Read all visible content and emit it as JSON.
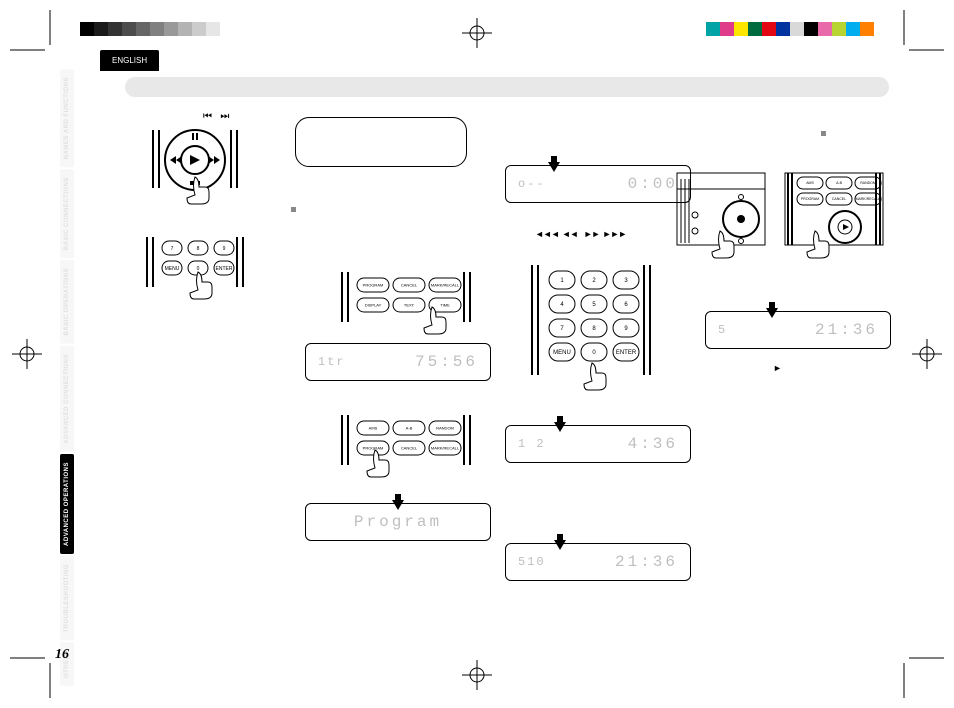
{
  "language_tab": "ENGLISH",
  "side_tabs": [
    {
      "label": "NAMES AND FUNCTIONS",
      "active": false
    },
    {
      "label": "BASIC CONNECTIONS",
      "active": false
    },
    {
      "label": "BASIC OPERATIONS",
      "active": false
    },
    {
      "label": "ADVANCED CONNECTIONS",
      "active": false
    },
    {
      "label": "ADVANCED OPERATIONS",
      "active": true
    },
    {
      "label": "TROUBLESHOOTING",
      "active": false
    },
    {
      "label": "OTHERS",
      "active": false
    }
  ],
  "page_number": "16",
  "displays": {
    "d1": {
      "left": "1tr",
      "right": "75:56"
    },
    "d2": {
      "left": "",
      "right": "Program"
    },
    "d3": {
      "left": "o--",
      "right": "0:00"
    },
    "d4": {
      "left": "1 2",
      "right": "4:36"
    },
    "d5": {
      "left": "510",
      "right": "21:36"
    },
    "d6": {
      "left": "5",
      "right": "21:36"
    }
  },
  "buttons": {
    "keypad": [
      "1",
      "2",
      "3",
      "4",
      "5",
      "6",
      "7",
      "8",
      "9",
      "MENU",
      "0",
      "ENTER"
    ],
    "rowA": [
      "PROGRAM",
      "CANCEL",
      "MARK/RECALL",
      "DISPLAY",
      "TEXT",
      "TIME"
    ],
    "rowB": [
      "AMS",
      "A-B",
      "RANDOM",
      "PROGRAM",
      "CANCEL",
      "MARK/RECALL"
    ],
    "rowNum": [
      "7",
      "8",
      "9",
      "MENU",
      "0",
      "ENTER"
    ]
  },
  "icons": {
    "skip_back": "⏮",
    "skip_fwd": "⏭",
    "rew2": "⏪⏪",
    "rew1": "⏪",
    "ff1": "⏩",
    "ff2": "⏩⏩",
    "play": "▶",
    "pause": "⏸"
  },
  "colorbars": {
    "gray": [
      "#000",
      "#1a1a1a",
      "#333",
      "#4d4d4d",
      "#666",
      "#808080",
      "#999",
      "#b3b3b3",
      "#ccc",
      "#e6e6e6",
      "#fff"
    ],
    "color": [
      "#00a4a6",
      "#e03a8a",
      "#ffe600",
      "#006b3f",
      "#e30613",
      "#0033a0",
      "#d9d9d9",
      "#000",
      "#e86aaa",
      "#b8d432",
      "#00adef",
      "#ff7f00"
    ]
  }
}
